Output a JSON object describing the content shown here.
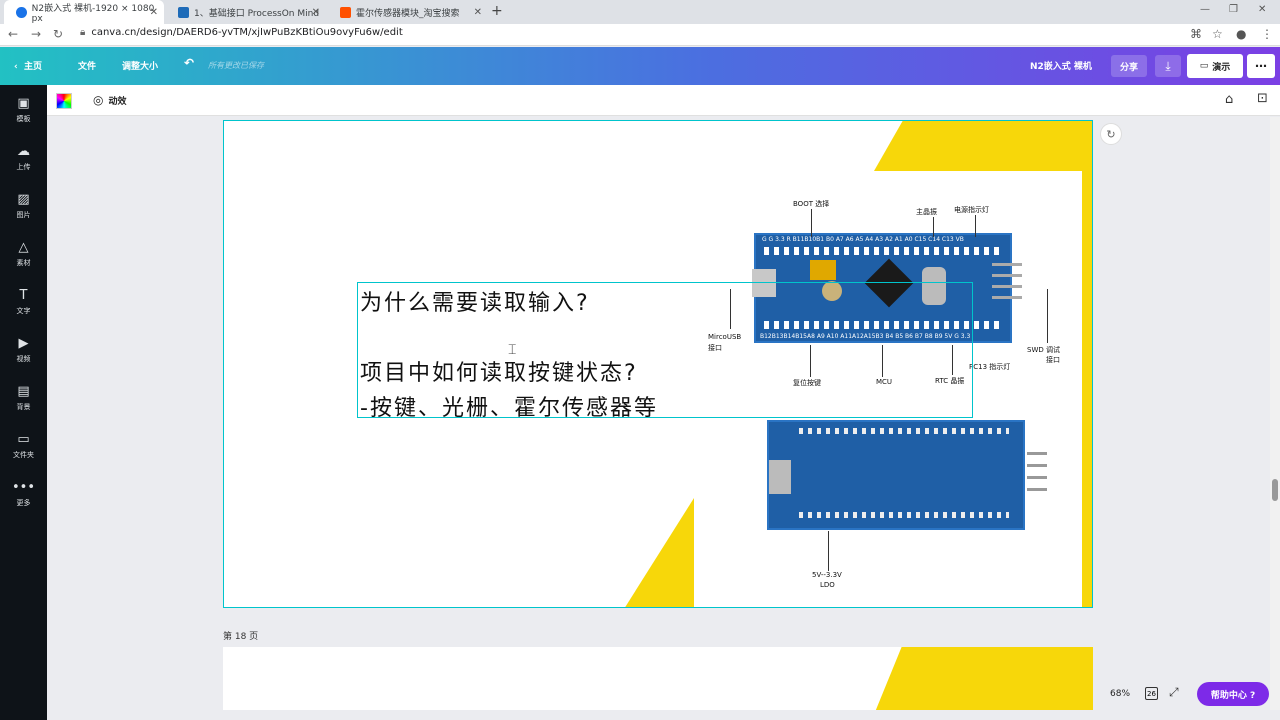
{
  "browser": {
    "tabs": [
      {
        "title": "N2嵌入式 裸机-1920 × 1080 px",
        "fav_color": "#1a73e8"
      },
      {
        "title": "1、基础接口 ProcessOn Mind",
        "fav_color": "#1e6bb8"
      },
      {
        "title": "霍尔传感器模块_淘宝搜索",
        "fav_color": "#ff5000"
      }
    ],
    "url": "canva.cn/design/DAERD6-yvTM/xjIwPuBzKBtiOu9ovyFu6w/edit"
  },
  "topbar": {
    "home": "主页",
    "file": "文件",
    "resize": "调整大小",
    "saved": "所有更改已保存",
    "design_title": "N2嵌入式 裸机",
    "share": "分享",
    "present": "演示"
  },
  "sidebar": {
    "items": [
      {
        "label": "模板",
        "icon": "▣"
      },
      {
        "label": "上传",
        "icon": "☁"
      },
      {
        "label": "图片",
        "icon": "▨"
      },
      {
        "label": "素材",
        "icon": "△"
      },
      {
        "label": "文字",
        "icon": "T"
      },
      {
        "label": "视频",
        "icon": "▶"
      },
      {
        "label": "背景",
        "icon": "▤"
      },
      {
        "label": "文件夹",
        "icon": "▭"
      },
      {
        "label": "更多",
        "icon": "•••"
      }
    ]
  },
  "toolbar": {
    "animate": "动效"
  },
  "slide": {
    "lines": [
      "为什么需要读取输入?",
      "",
      "项目中如何读取按键状态?",
      "-按键、光栅、霍尔传感器等"
    ],
    "board_labels": {
      "boot": "BOOT 选择",
      "xtal": "主晶振",
      "power_led": "电源指示灯",
      "usb": "MircoUSB",
      "usb2": "接口",
      "swd": "SWD 调试",
      "swd2": "接口",
      "reset": "复位按键",
      "mcu": "MCU",
      "rtc": "RTC 晶振",
      "pc13": "PC13 指示灯",
      "ldo1": "5V--3.3V",
      "ldo2": "LDO",
      "top_pins": "G G 3.3 R B11B10B1 B0 A7 A6 A5 A4 A3 A2 A1 A0 C15 C14 C13 VB",
      "bottom_pins": "B12B13B14B15A8 A9 A10 A11A12A15B3 B4 B5 B6 B7 B8 B9 5V G 3.3"
    }
  },
  "footer": {
    "page_label": "第 18 页",
    "zoom": "68%",
    "page_count": "26",
    "help": "帮助中心 ?"
  }
}
